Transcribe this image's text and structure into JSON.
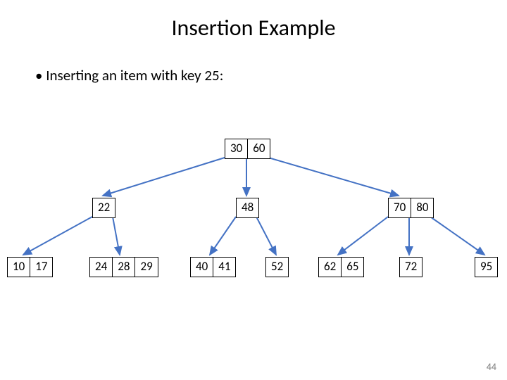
{
  "title": "Insertion Example",
  "bullet_text": "Inserting an item with key 25:",
  "page_number": "44",
  "tree": {
    "root": {
      "keys": [
        "30",
        "60"
      ]
    },
    "mid": [
      {
        "keys": [
          "22"
        ]
      },
      {
        "keys": [
          "48"
        ]
      },
      {
        "keys": [
          "70",
          "80"
        ]
      }
    ],
    "leaves": [
      {
        "keys": [
          "10",
          "17"
        ]
      },
      {
        "keys": [
          "24",
          "28",
          "29"
        ]
      },
      {
        "keys": [
          "40",
          "41"
        ]
      },
      {
        "keys": [
          "52"
        ]
      },
      {
        "keys": [
          "62",
          "65"
        ]
      },
      {
        "keys": [
          "72"
        ]
      },
      {
        "keys": [
          "95"
        ]
      }
    ]
  }
}
